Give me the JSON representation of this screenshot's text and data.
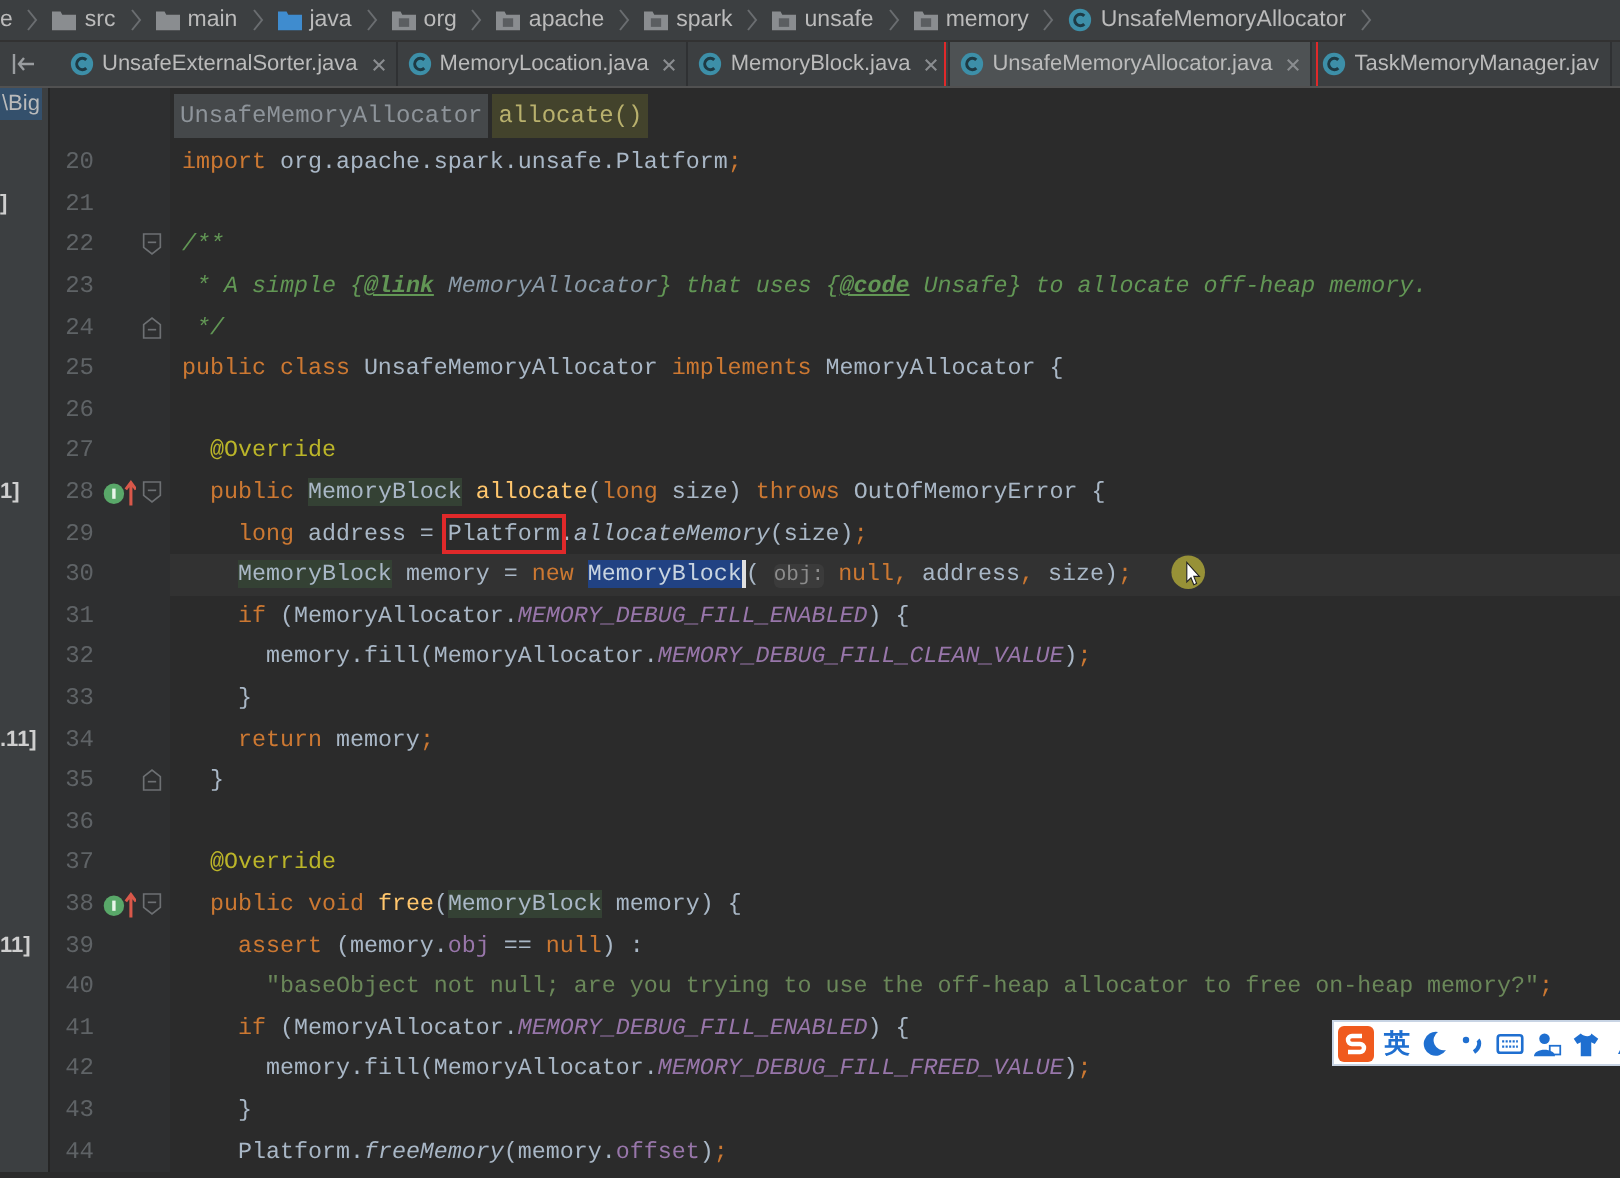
{
  "nav_bar": {
    "items": [
      {
        "label": "e",
        "kind": "partial"
      },
      {
        "label": "src",
        "kind": "folder"
      },
      {
        "label": "main",
        "kind": "folder"
      },
      {
        "label": "java",
        "kind": "source-folder"
      },
      {
        "label": "org",
        "kind": "package"
      },
      {
        "label": "apache",
        "kind": "package"
      },
      {
        "label": "spark",
        "kind": "package"
      },
      {
        "label": "unsafe",
        "kind": "package"
      },
      {
        "label": "memory",
        "kind": "package"
      },
      {
        "label": "UnsafeMemoryAllocator",
        "kind": "class"
      }
    ]
  },
  "tabs": [
    {
      "label": "UnsafeExternalSorter.java",
      "selected": false,
      "closable": true,
      "annotated": false
    },
    {
      "label": "MemoryLocation.java",
      "selected": false,
      "closable": true,
      "annotated": false
    },
    {
      "label": "MemoryBlock.java",
      "selected": false,
      "closable": true,
      "annotated": false
    },
    {
      "label": "UnsafeMemoryAllocator.java",
      "selected": true,
      "closable": true,
      "annotated": true
    },
    {
      "label": "TaskMemoryManager.jav",
      "selected": false,
      "closable": false,
      "annotated": false
    }
  ],
  "project_panel": {
    "top_item": {
      "label": "\\Big",
      "selected": true
    }
  },
  "editor_breadcrumb": [
    {
      "label": "UnsafeMemoryAllocator",
      "kind": "class"
    },
    {
      "label": "allocate()",
      "kind": "method"
    }
  ],
  "lines": [
    {
      "number": "20",
      "current": false,
      "tokens": [
        {
          "t": "import",
          "kind": "kw"
        },
        {
          "t": " org.apache.spark.unsafe.Platform",
          "kind": "plain"
        },
        {
          "t": ";",
          "kind": "kw"
        }
      ]
    },
    {
      "number": "21",
      "current": false,
      "tree_text": "]"
    },
    {
      "number": "22",
      "current": false,
      "fold": {
        "kind": "start"
      },
      "tokens": [
        {
          "t": "/**",
          "kind": "cmt"
        }
      ]
    },
    {
      "number": "23",
      "current": false,
      "tokens": [
        {
          "t": " * A simple {",
          "kind": "cmt"
        },
        {
          "t": "@link",
          "kind": "tag"
        },
        {
          "t": " MemoryAllocator",
          "kind": "cref"
        },
        {
          "t": "} that uses {",
          "kind": "cmt"
        },
        {
          "t": "@code",
          "kind": "tag"
        },
        {
          "t": " Unsafe} to allocate off-heap memory.",
          "kind": "cmt"
        }
      ]
    },
    {
      "number": "24",
      "current": false,
      "fold": {
        "kind": "end"
      },
      "tokens": [
        {
          "t": " */",
          "kind": "cmt"
        }
      ]
    },
    {
      "number": "25",
      "current": false,
      "tokens": [
        {
          "t": "public class ",
          "kind": "kw"
        },
        {
          "t": "UnsafeMemoryAllocator ",
          "kind": "plain"
        },
        {
          "t": "implements ",
          "kind": "kw"
        },
        {
          "t": "MemoryAllocator {",
          "kind": "plain"
        }
      ]
    },
    {
      "number": "26",
      "current": false
    },
    {
      "number": "27",
      "current": false,
      "tokens": [
        {
          "t": "  @Override",
          "kind": "ann"
        }
      ]
    },
    {
      "number": "28",
      "current": false,
      "tree_text": "1]",
      "marker": {
        "kind": "implements"
      },
      "fold": {
        "kind": "start"
      },
      "tokens": [
        {
          "t": "  public ",
          "kind": "kw"
        },
        {
          "t": "MemoryBlock",
          "kind": "type"
        },
        {
          "t": " allocate",
          "kind": "fn"
        },
        {
          "t": "(",
          "kind": "plain"
        },
        {
          "t": "long",
          "kind": "kw"
        },
        {
          "t": " size) ",
          "kind": "plain"
        },
        {
          "t": "throws ",
          "kind": "kw"
        },
        {
          "t": "OutOfMemoryError {",
          "kind": "plain"
        }
      ]
    },
    {
      "number": "29",
      "current": false,
      "tokens": [
        {
          "t": "    long ",
          "kind": "kw"
        },
        {
          "t": "address = ",
          "kind": "plain"
        },
        {
          "t": "Platform",
          "kind": "plain",
          "annotated": true
        },
        {
          "t": ".",
          "kind": "plain"
        },
        {
          "t": "allocateMemory",
          "kind": "ifn"
        },
        {
          "t": "(size)",
          "kind": "plain"
        },
        {
          "t": ";",
          "kind": "kw"
        }
      ]
    },
    {
      "number": "30",
      "current": true,
      "tokens": [
        {
          "t": "    MemoryBlock",
          "kind": "type"
        },
        {
          "t": " memory = ",
          "kind": "plain"
        },
        {
          "t": "new ",
          "kind": "kw"
        },
        {
          "t": "MemoryBlock",
          "kind": "selection"
        },
        {
          "t": "( ",
          "kind": "plain"
        },
        {
          "t": "obj:",
          "kind": "hint"
        },
        {
          "t": " null,",
          "kind": "kw"
        },
        {
          "t": " address",
          "kind": "plain"
        },
        {
          "t": ",",
          "kind": "kw"
        },
        {
          "t": " size)",
          "kind": "plain"
        },
        {
          "t": ";",
          "kind": "kw"
        }
      ]
    },
    {
      "number": "31",
      "current": false,
      "tokens": [
        {
          "t": "    if ",
          "kind": "kw"
        },
        {
          "t": "(MemoryAllocator.",
          "kind": "plain"
        },
        {
          "t": "MEMORY_DEBUG_FILL_ENABLED",
          "kind": "const"
        },
        {
          "t": ") {",
          "kind": "plain"
        }
      ]
    },
    {
      "number": "32",
      "current": false,
      "tokens": [
        {
          "t": "      memory.fill(MemoryAllocator.",
          "kind": "plain"
        },
        {
          "t": "MEMORY_DEBUG_FILL_CLEAN_VALUE",
          "kind": "const"
        },
        {
          "t": ")",
          "kind": "plain"
        },
        {
          "t": ";",
          "kind": "kw"
        }
      ]
    },
    {
      "number": "33",
      "current": false,
      "tokens": [
        {
          "t": "    }",
          "kind": "plain"
        }
      ]
    },
    {
      "number": "34",
      "current": false,
      "tree_text": ".11]",
      "tokens": [
        {
          "t": "    return ",
          "kind": "kw"
        },
        {
          "t": "memory",
          "kind": "plain"
        },
        {
          "t": ";",
          "kind": "kw"
        }
      ]
    },
    {
      "number": "35",
      "current": false,
      "fold": {
        "kind": "end"
      },
      "tokens": [
        {
          "t": "  }",
          "kind": "plain"
        }
      ]
    },
    {
      "number": "36",
      "current": false
    },
    {
      "number": "37",
      "current": false,
      "tokens": [
        {
          "t": "  @Override",
          "kind": "ann"
        }
      ]
    },
    {
      "number": "38",
      "current": false,
      "marker": {
        "kind": "implements"
      },
      "fold": {
        "kind": "start"
      },
      "tokens": [
        {
          "t": "  public void ",
          "kind": "kw"
        },
        {
          "t": "free",
          "kind": "fn"
        },
        {
          "t": "(",
          "kind": "plain"
        },
        {
          "t": "MemoryBlock",
          "kind": "type"
        },
        {
          "t": " memory) {",
          "kind": "plain"
        }
      ]
    },
    {
      "number": "39",
      "current": false,
      "tree_text": "11]",
      "tokens": [
        {
          "t": "    assert ",
          "kind": "kw"
        },
        {
          "t": "(memory.",
          "kind": "plain"
        },
        {
          "t": "obj",
          "kind": "field"
        },
        {
          "t": " == ",
          "kind": "plain"
        },
        {
          "t": "null",
          "kind": "kw"
        },
        {
          "t": ") :",
          "kind": "plain"
        }
      ]
    },
    {
      "number": "40",
      "current": false,
      "tokens": [
        {
          "t": "      \"baseObject not null; are you trying to use the off-heap allocator to free on-heap memory?\"",
          "kind": "str"
        },
        {
          "t": ";",
          "kind": "kw"
        }
      ]
    },
    {
      "number": "41",
      "current": false,
      "tokens": [
        {
          "t": "    if ",
          "kind": "kw"
        },
        {
          "t": "(MemoryAllocator.",
          "kind": "plain"
        },
        {
          "t": "MEMORY_DEBUG_FILL_ENABLED",
          "kind": "const"
        },
        {
          "t": ") {",
          "kind": "plain"
        }
      ]
    },
    {
      "number": "42",
      "current": false,
      "tokens": [
        {
          "t": "      memory.fill(MemoryAllocator.",
          "kind": "plain"
        },
        {
          "t": "MEMORY_DEBUG_FILL_FREED_VALUE",
          "kind": "const"
        },
        {
          "t": ")",
          "kind": "plain"
        },
        {
          "t": ";",
          "kind": "kw"
        }
      ]
    },
    {
      "number": "43",
      "current": false,
      "tokens": [
        {
          "t": "    }",
          "kind": "plain"
        }
      ]
    },
    {
      "number": "44",
      "current": false,
      "tokens": [
        {
          "t": "    Platform.",
          "kind": "plain"
        },
        {
          "t": "freeMemory",
          "kind": "ifn"
        },
        {
          "t": "(memory.",
          "kind": "plain"
        },
        {
          "t": "offset",
          "kind": "field"
        },
        {
          "t": ")",
          "kind": "plain"
        },
        {
          "t": ";",
          "kind": "kw"
        }
      ]
    }
  ],
  "ime_toolbar": {
    "mode": "英"
  }
}
